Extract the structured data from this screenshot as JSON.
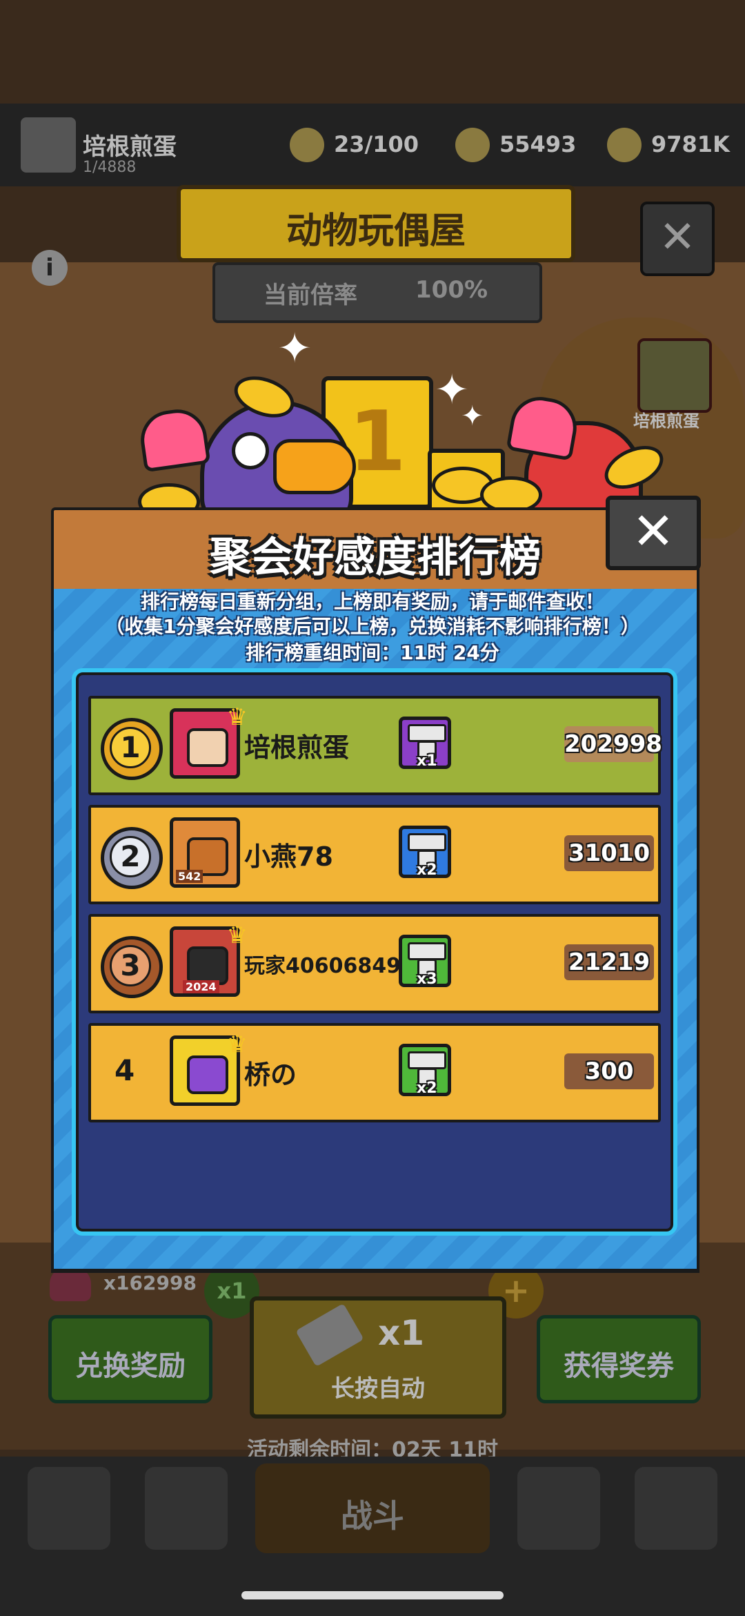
{
  "background": {
    "player_name": "培根煎蛋",
    "player_sub": "1/4888",
    "resource_1": "23/100",
    "resource_2": "55493",
    "resource_3": "9781K",
    "scene_title": "动物玩偶屋",
    "rate_label": "当前倍率",
    "rate_value": "100%",
    "side_name": "培根煎蛋",
    "heart_count": "x162998",
    "x1_bubble": "x1",
    "exchange_button": "兑换奖励",
    "auto_count": "x1",
    "auto_label": "长按自动",
    "get_ticket_button": "获得奖券",
    "remaining_time": "活动剩余时间：02天 11时",
    "fight_label": "战斗"
  },
  "modal": {
    "title": "聚会好感度排行榜",
    "close_label": "✕",
    "notice_line1": "排行榜每日重新分组，上榜即有奖励，请于邮件查收！",
    "notice_line2": "（收集1分聚会好感度后可以上榜，兑换消耗不影响排行榜！）",
    "notice_line3": "排行榜重组时间：11时 24分",
    "trophy_number": "1"
  },
  "leaderboard": [
    {
      "rank": "1",
      "name": "培根煎蛋",
      "reward": "x1",
      "score": "202998",
      "reward_color": "purple"
    },
    {
      "rank": "2",
      "name": "小燕78",
      "reward": "x2",
      "score": "31010",
      "reward_color": "blue",
      "avatar_badge": "542"
    },
    {
      "rank": "3",
      "name": "玩家40606849",
      "reward": "x3",
      "score": "21219",
      "reward_color": "green",
      "avatar_badge": "2024"
    },
    {
      "rank": "4",
      "name": "桥の",
      "reward": "x2",
      "score": "300",
      "reward_color": "green"
    }
  ],
  "colors": {
    "first_row": "#9db23a",
    "other_row": "#f2b436",
    "modal_header": "#c27a3a",
    "modal_body": "#3d9de0",
    "list_frame": "#2c3a7a"
  }
}
